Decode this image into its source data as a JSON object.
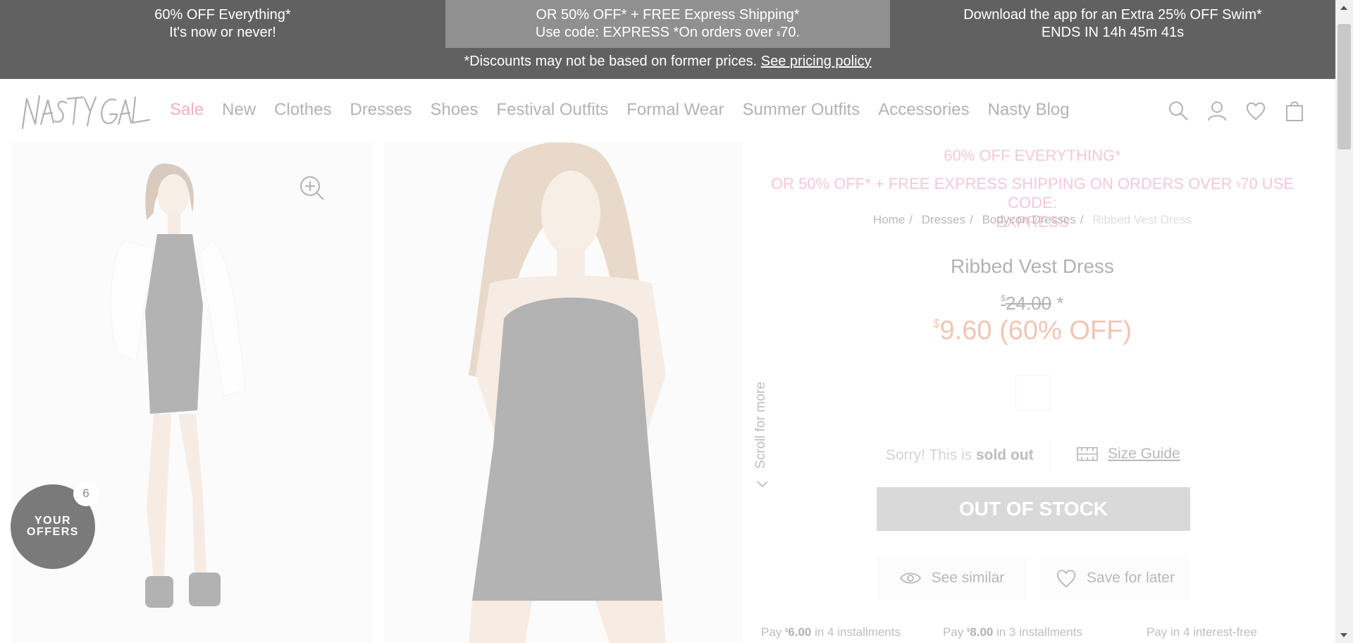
{
  "promo": {
    "cell1_line1": "60% OFF Everything*",
    "cell1_line2": "It's now or never!",
    "cell2_line1": "OR 50% OFF* + FREE Express Shipping*",
    "cell2_line2_pre": "Use code: EXPRESS *On orders over ",
    "cell2_line2_cur": "$",
    "cell2_line2_amt": "70.",
    "cell3_line1": "Download the app for an Extra 25% OFF Swim*",
    "cell3_line2": "ENDS IN 14h 45m 41s",
    "note": "*Discounts may not be based on former prices.",
    "note_link": "See pricing policy"
  },
  "header": {
    "logo_alt": "NASTY GAL",
    "nav": [
      "Sale",
      "New",
      "Clothes",
      "Dresses",
      "Shoes",
      "Festival Outfits",
      "Formal Wear",
      "Summer Outfits",
      "Accessories",
      "Nasty Blog"
    ]
  },
  "gallery": {
    "scroll_hint": "Scroll for more",
    "offers_line1": "YOUR",
    "offers_line2": "OFFERS",
    "offers_count": "6"
  },
  "product": {
    "promo_line1": "60% OFF EVERYTHING*",
    "promo_line2_pre": "OR 50% OFF* + FREE EXPRESS SHIPPING ON ORDERS OVER ",
    "promo_line2_cur": "$",
    "promo_line2_post": "70 USE CODE:",
    "promo_line3": "EXPRESS",
    "breadcrumbs": [
      "Home",
      "Dresses",
      "Bodycon Dresses"
    ],
    "breadcrumb_current": "Ribbed Vest Dress",
    "title": "Ribbed Vest Dress",
    "was_currency": "$",
    "was_amount": "24.00",
    "was_asterisk": " *",
    "now_currency": "$",
    "now_text": "9.60 (60% OFF)",
    "sold_pre": "Sorry! This is ",
    "sold_bold": "sold out",
    "size_guide": "Size Guide",
    "out_of_stock": "OUT OF STOCK",
    "see_similar": "See similar",
    "save_later": "Save for later",
    "pay1_pre": "Pay ",
    "pay1_cur": "$",
    "pay1_amt": "6.00",
    "pay1_post": " in 4 installments",
    "pay2_pre": "Pay ",
    "pay2_cur": "$",
    "pay2_amt": "8.00",
    "pay2_post": " in 3 installments",
    "pay3": "Pay in 4 interest-free"
  },
  "colors": {
    "sale": "#d80b2a",
    "promo_pink": "#e4527a",
    "price": "#d94a15",
    "banner": "#000000"
  }
}
